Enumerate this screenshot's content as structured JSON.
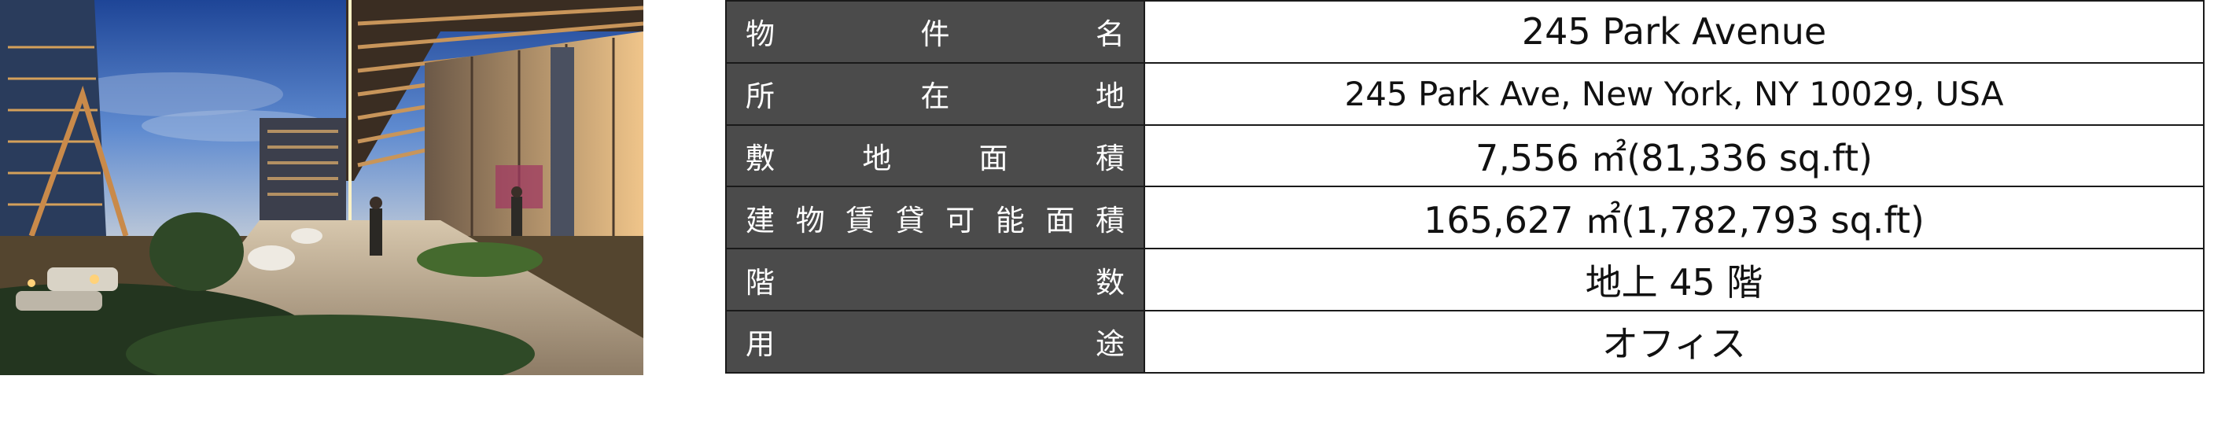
{
  "photo": {
    "subject": "rooftop-terrace-night-rendering"
  },
  "table": {
    "rows": [
      {
        "label": "物件名",
        "value": "245 Park Avenue"
      },
      {
        "label": "所在地",
        "value": "245 Park Ave, New York, NY 10029, USA"
      },
      {
        "label": "敷地面積",
        "value": "7,556 ㎡(81,336 sq.ft)"
      },
      {
        "label": "建物賃貸可能面積",
        "value": "165,627 ㎡(1,782,793 sq.ft)"
      },
      {
        "label": "階数",
        "value": "地上 45 階"
      },
      {
        "label": "用途",
        "value": "オフィス"
      }
    ]
  },
  "colors": {
    "label_bg": "#4b4b4b",
    "label_text": "#ffffff",
    "border": "#1a1a1a"
  }
}
